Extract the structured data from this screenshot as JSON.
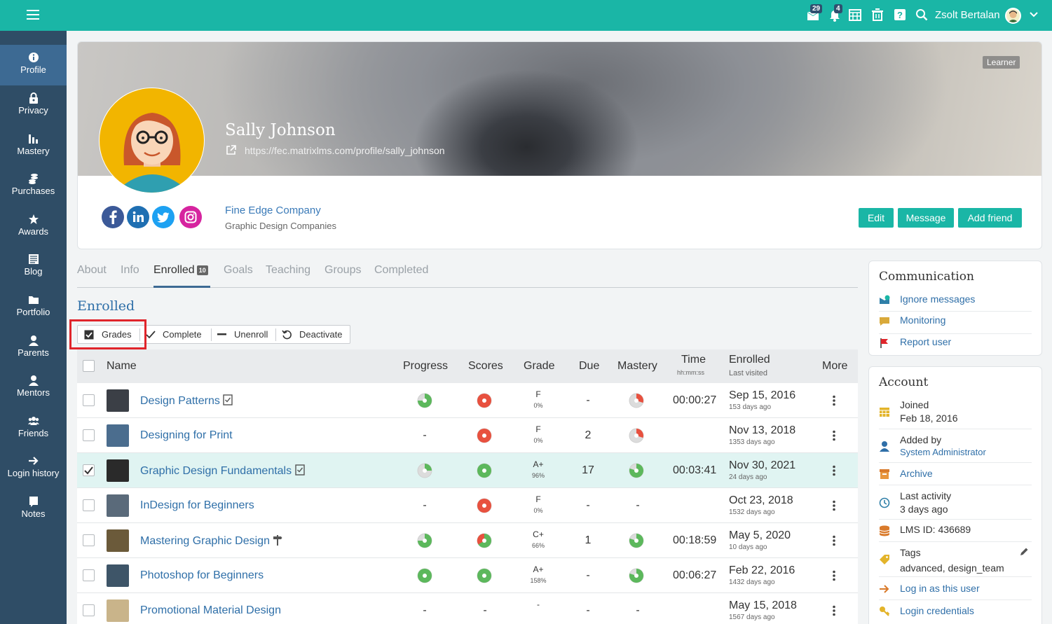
{
  "topbar": {
    "menu_icon": "hamburger-icon",
    "messages_badge": "29",
    "notifications_badge": "4",
    "user_name": "Zsolt Bertalan",
    "icons": [
      "messages-icon",
      "notifications-icon",
      "calendar-icon",
      "trash-icon",
      "help-icon",
      "search-icon",
      "chevron-down-icon"
    ]
  },
  "sidebar": {
    "items": [
      {
        "label": "Profile",
        "icon": "info-icon",
        "active": true
      },
      {
        "label": "Privacy",
        "icon": "lock-icon"
      },
      {
        "label": "Mastery",
        "icon": "bar-chart-icon"
      },
      {
        "label": "Purchases",
        "icon": "coins-icon"
      },
      {
        "label": "Awards",
        "icon": "star-icon"
      },
      {
        "label": "Blog",
        "icon": "blog-icon"
      },
      {
        "label": "Portfolio",
        "icon": "folder-icon"
      },
      {
        "label": "Parents",
        "icon": "user-icon"
      },
      {
        "label": "Mentors",
        "icon": "user-icon"
      },
      {
        "label": "Friends",
        "icon": "users-icon"
      },
      {
        "label": "Login history",
        "icon": "arrow-right-icon"
      },
      {
        "label": "Notes",
        "icon": "note-icon"
      }
    ]
  },
  "profile": {
    "role_tag": "Learner",
    "name": "Sally Johnson",
    "url": "https://fec.matrixlms.com/profile/sally_johnson",
    "company": "Fine Edge Company",
    "company_group": "Graphic Design Companies",
    "social": [
      "facebook-icon",
      "linkedin-icon",
      "twitter-icon",
      "instagram-icon"
    ],
    "buttons": {
      "edit": "Edit",
      "message": "Message",
      "add_friend": "Add friend"
    }
  },
  "tabs": [
    {
      "label": "About"
    },
    {
      "label": "Info"
    },
    {
      "label": "Enrolled",
      "count": "10",
      "active": true
    },
    {
      "label": "Goals"
    },
    {
      "label": "Teaching"
    },
    {
      "label": "Groups"
    },
    {
      "label": "Completed"
    }
  ],
  "section_title": "Enrolled",
  "actions": {
    "grades": "Grades",
    "complete": "Complete",
    "unenroll": "Unenroll",
    "deactivate": "Deactivate"
  },
  "table": {
    "headers": {
      "name": "Name",
      "progress": "Progress",
      "scores": "Scores",
      "grade": "Grade",
      "due": "Due",
      "mastery": "Mastery",
      "time": "Time",
      "time_sub": "hh:mm:ss",
      "enrolled": "Enrolled",
      "enrolled_sub": "Last visited",
      "more": "More"
    },
    "rows": [
      {
        "course": "Design Patterns",
        "badge": "certificate-icon",
        "progress": 0.75,
        "scores": "red",
        "grade": "F",
        "grade_pct": "0%",
        "due": "-",
        "mastery": "partial",
        "time": "00:00:27",
        "date": "Sep 15, 2016",
        "ago": "153 days ago"
      },
      {
        "course": "Designing for Print",
        "badge": "",
        "progress": null,
        "scores": "red",
        "grade": "F",
        "grade_pct": "0%",
        "due": "2",
        "mastery": "partial",
        "time": "",
        "date": "Nov 13, 2018",
        "ago": "1353 days ago"
      },
      {
        "course": "Graphic Design Fundamentals",
        "badge": "certificate-icon",
        "progress": 0.25,
        "scores": "green",
        "grade": "A+",
        "grade_pct": "96%",
        "due": "17",
        "mastery": "mostly",
        "time": "00:03:41",
        "date": "Nov 30, 2021",
        "ago": "24 days ago",
        "selected": true
      },
      {
        "course": "InDesign for Beginners",
        "badge": "",
        "progress": null,
        "scores": "red",
        "grade": "F",
        "grade_pct": "0%",
        "due": "-",
        "mastery": null,
        "time": "",
        "date": "Oct 23, 2018",
        "ago": "1532 days ago"
      },
      {
        "course": "Mastering Graphic Design",
        "badge": "signpost-icon",
        "progress": 0.75,
        "scores": "mixed",
        "grade": "C+",
        "grade_pct": "66%",
        "due": "1",
        "mastery": "mostly",
        "time": "00:18:59",
        "date": "May 5, 2020",
        "ago": "10 days ago"
      },
      {
        "course": "Photoshop for Beginners",
        "badge": "",
        "progress": 1.0,
        "scores": "green",
        "grade": "A+",
        "grade_pct": "158%",
        "due": "-",
        "mastery": "mostly",
        "time": "00:06:27",
        "date": "Feb 22, 2016",
        "ago": "1432 days ago"
      },
      {
        "course": "Promotional Material Design",
        "badge": "",
        "progress": null,
        "scores": null,
        "grade": "-",
        "grade_pct": "",
        "due": "-",
        "mastery": null,
        "time": "",
        "date": "May 15, 2018",
        "ago": "1567 days ago"
      }
    ],
    "empty": "-"
  },
  "communication": {
    "title": "Communication",
    "items": [
      {
        "label": "Ignore messages",
        "icon": "envelope-block-icon"
      },
      {
        "label": "Monitoring",
        "icon": "chat-icon"
      },
      {
        "label": "Report user",
        "icon": "flag-icon"
      }
    ]
  },
  "account": {
    "title": "Account",
    "joined_label": "Joined",
    "joined": "Feb 18, 2016",
    "added_label": "Added by",
    "added_by": "System Administrator",
    "archive": "Archive",
    "last_activity_label": "Last activity",
    "last_activity": "3 days ago",
    "lms_id": "LMS ID: 436689",
    "tags_label": "Tags",
    "tags": "advanced, design_team",
    "login_as": "Log in as this user",
    "login_credentials": "Login credentials"
  },
  "colors": {
    "teal": "#1ab6a6",
    "sidebar": "#2f4d66",
    "link": "#2f6fa8",
    "green": "#5cb85c",
    "red": "#e8513f"
  }
}
